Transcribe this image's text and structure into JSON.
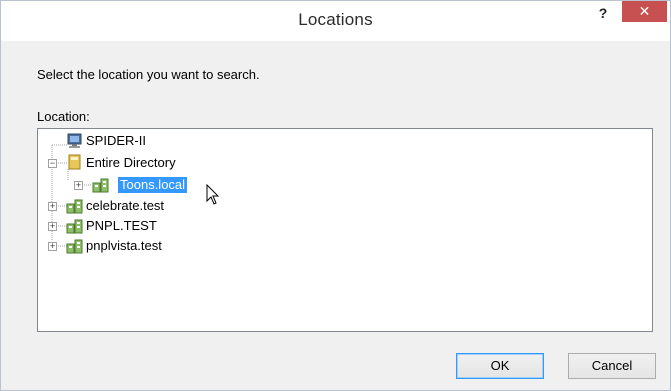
{
  "window": {
    "title": "Locations",
    "help_label": "?",
    "close_label": "✕"
  },
  "dialog": {
    "prompt": "Select the location you want to search.",
    "location_label": "Location:"
  },
  "tree": {
    "items": [
      {
        "label": "SPIDER-II",
        "icon": "computer-icon",
        "expander": ""
      },
      {
        "label": "Entire Directory",
        "icon": "directory-book-icon",
        "expander": "−"
      },
      {
        "label": "Toons.local",
        "icon": "domain-icon",
        "expander": "+",
        "selected": true
      },
      {
        "label": "celebrate.test",
        "icon": "domain-icon",
        "expander": "+"
      },
      {
        "label": "PNPL.TEST",
        "icon": "domain-icon",
        "expander": "+"
      },
      {
        "label": "pnplvista.test",
        "icon": "domain-icon",
        "expander": "+"
      }
    ]
  },
  "buttons": {
    "ok": "OK",
    "cancel": "Cancel"
  },
  "colors": {
    "selection": "#3399ff",
    "close_button": "#c75050"
  }
}
